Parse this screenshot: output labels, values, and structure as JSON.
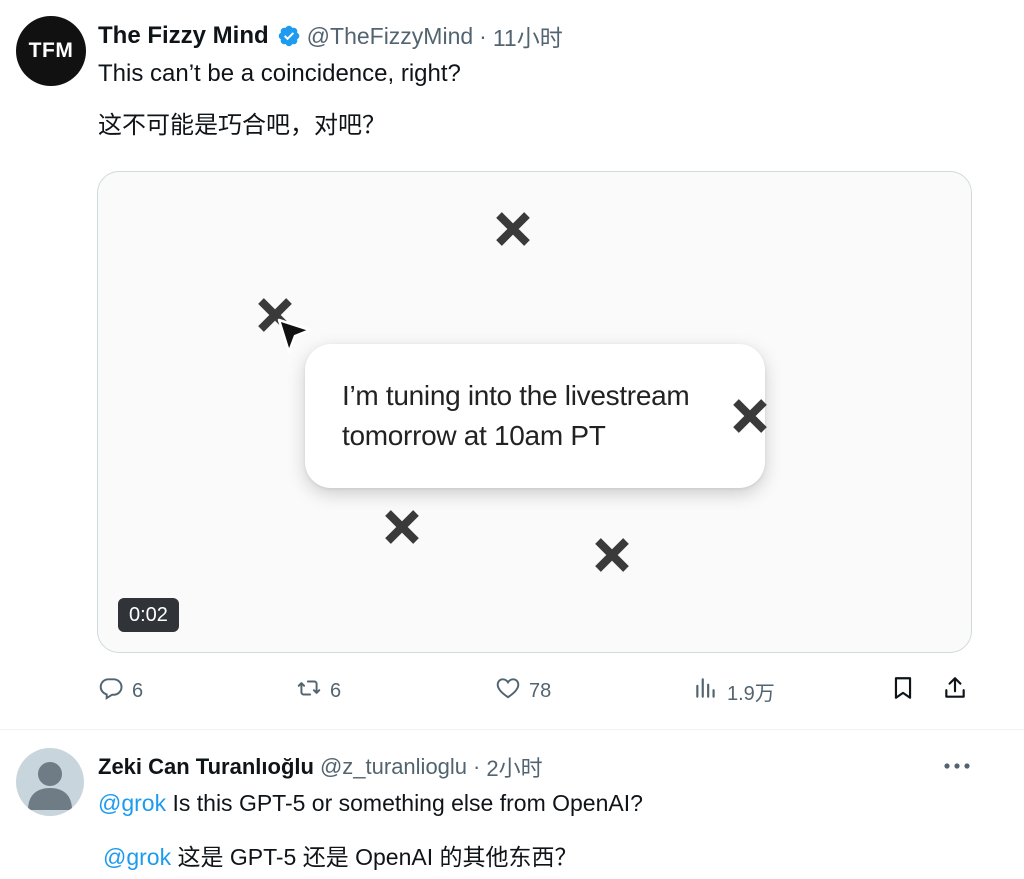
{
  "tweet": {
    "avatar_text": "TFM",
    "display_name": "The Fizzy Mind",
    "handle": "@TheFizzyMind",
    "separator": "·",
    "time": "11小时",
    "text_line1": "This can’t be a coincidence, right?",
    "text_line2": "这不可能是巧合吧，对吧？",
    "verified_color": "#1d9bf0",
    "media": {
      "bubble_line1": "I’m tuning into the livestream",
      "bubble_line2": "tomorrow at 10am PT",
      "duration": "0:02"
    },
    "actions": {
      "replies": "6",
      "retweets": "6",
      "likes": "78",
      "views": "1.9万"
    }
  },
  "reply": {
    "display_name": "Zeki Can Turanlıoğlu",
    "handle": "@z_turanlioglu",
    "separator": "·",
    "time": "2小时",
    "mention": "@grok",
    "text_line1": " Is this GPT-5 or something else from OpenAI?",
    "text_line2": " 这是 GPT-5 还是 OpenAI 的其他东西？"
  },
  "colors": {
    "link": "#1d9bf0",
    "secondary_text": "#536471",
    "primary_text": "#0f1419"
  },
  "icons": [
    "verified-badge-icon",
    "x-mark-icon",
    "cursor-arrow-icon",
    "reply-icon",
    "retweet-icon",
    "like-icon",
    "views-icon",
    "bookmark-icon",
    "share-icon",
    "more-icon",
    "default-avatar-icon"
  ]
}
